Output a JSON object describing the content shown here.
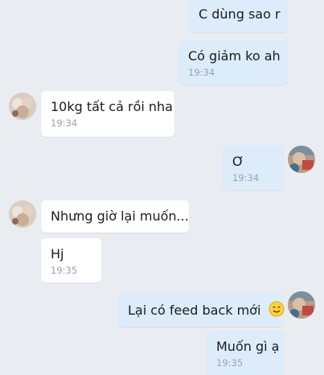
{
  "messages": [
    {
      "side": "out",
      "text": "C dùng sao r",
      "time": ""
    },
    {
      "side": "out",
      "text": "Có giảm ko ah",
      "time": "19:34"
    },
    {
      "side": "in",
      "text": "10kg tất cả rồi nha",
      "time": "19:34"
    },
    {
      "side": "out",
      "text": "Ơ",
      "time": "19:34"
    },
    {
      "side": "in",
      "text": "Nhưng giờ lại muốn...",
      "time": ""
    },
    {
      "side": "in",
      "text": "Hj",
      "time": "19:35"
    },
    {
      "side": "out",
      "text": "Lại có feed back mới",
      "time": "",
      "emoji": "smiling-face-emoji"
    },
    {
      "side": "out",
      "text": "Muốn gì ạ",
      "time": "19:35"
    }
  ],
  "colors": {
    "background": "#e9ecf1",
    "outgoing_bubble": "#dcecfb",
    "incoming_bubble": "#ffffff",
    "timestamp": "#9aa2ab"
  }
}
